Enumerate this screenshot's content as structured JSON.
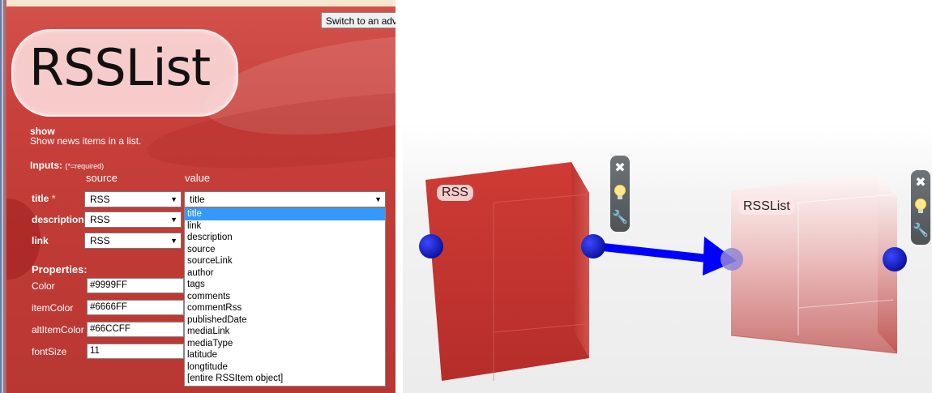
{
  "editor": {
    "switch_button": "Switch to an adv",
    "title": "RSSList",
    "operation": "show",
    "description": "Show news items in a list.",
    "inputs_heading": "Inputs:",
    "inputs_note": "(*=required)",
    "col_source": "source",
    "col_value": "value",
    "inputs": [
      {
        "label": "title",
        "required": "*",
        "source": "RSS",
        "value": "title"
      },
      {
        "label": "description",
        "source": "RSS"
      },
      {
        "label": "link",
        "source": "RSS"
      }
    ],
    "dropdown_options": [
      "title",
      "link",
      "description",
      "source",
      "sourceLink",
      "author",
      "tags",
      "comments",
      "commentRss",
      "publishedDate",
      "mediaLink",
      "mediaType",
      "latitude",
      "longtitude",
      "[entire RSSItem object]"
    ],
    "dropdown_selected": "title",
    "properties_heading": "Properties:",
    "properties": [
      {
        "label": "Color",
        "value": "#9999FF"
      },
      {
        "label": "itemColor",
        "value": "#6666FF"
      },
      {
        "label": "altItemColor",
        "value": "#66CCFF"
      },
      {
        "label": "fontSize",
        "value": "11"
      }
    ]
  },
  "canvas": {
    "cubes": [
      {
        "label": "RSS",
        "color": "#c0302c"
      },
      {
        "label": "RSSList",
        "color": "#e8b0b0"
      }
    ],
    "connector_color": "#0000ff",
    "port_color": "#1a24c8",
    "toolbar_icons": [
      "close-icon",
      "lightbulb-icon",
      "wrench-icon"
    ]
  }
}
